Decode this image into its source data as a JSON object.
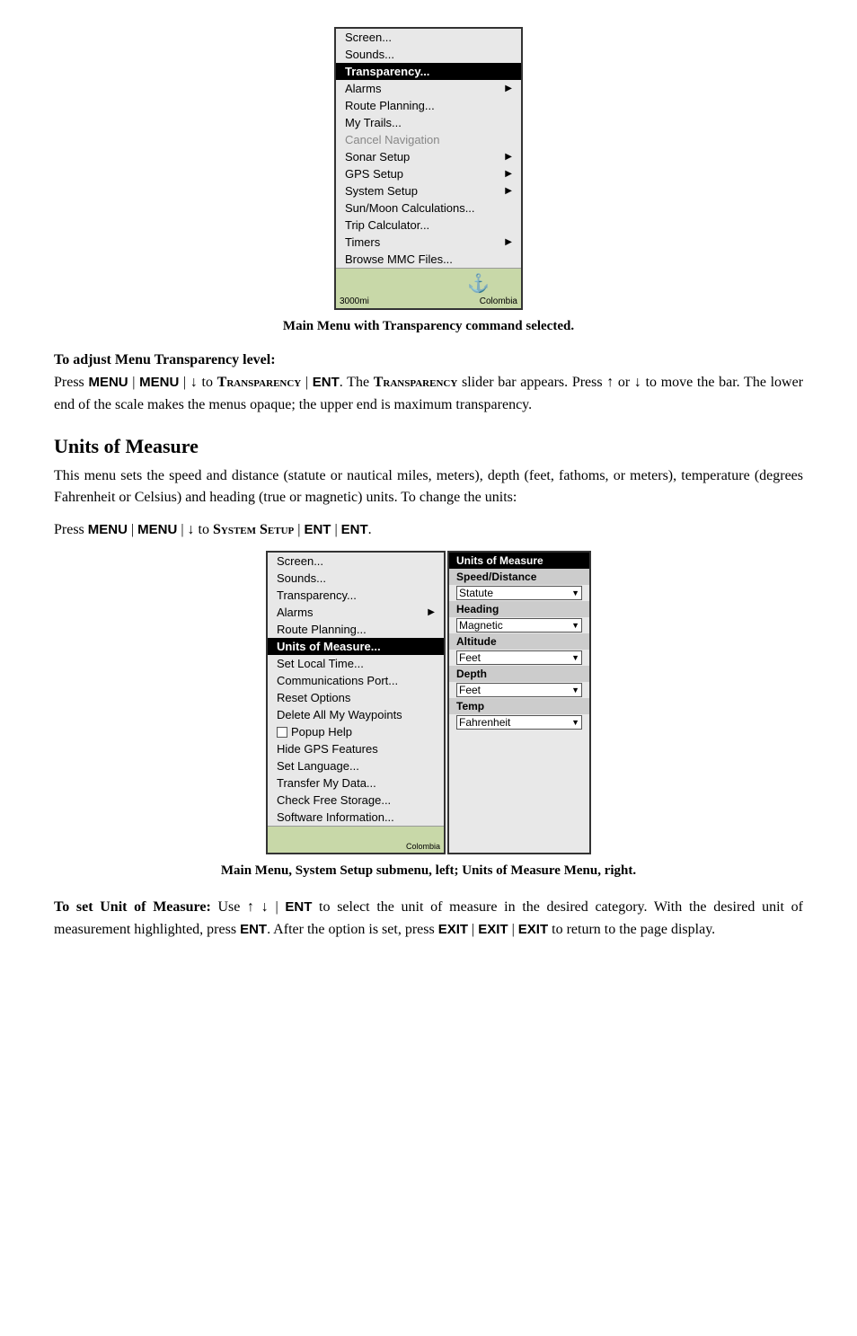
{
  "menu1": {
    "items": [
      {
        "label": "Screen...",
        "type": "normal"
      },
      {
        "label": "Sounds...",
        "type": "normal"
      },
      {
        "label": "Transparency...",
        "type": "highlighted"
      },
      {
        "label": "Alarms",
        "type": "arrow"
      },
      {
        "label": "Route Planning...",
        "type": "normal"
      },
      {
        "label": "My Trails...",
        "type": "normal"
      },
      {
        "label": "Cancel Navigation",
        "type": "disabled"
      },
      {
        "label": "Sonar Setup",
        "type": "arrow"
      },
      {
        "label": "GPS Setup",
        "type": "arrow"
      },
      {
        "label": "System Setup",
        "type": "arrow"
      },
      {
        "label": "Sun/Moon Calculations...",
        "type": "normal"
      },
      {
        "label": "Trip Calculator...",
        "type": "normal"
      },
      {
        "label": "Timers",
        "type": "arrow"
      },
      {
        "label": "Browse MMC Files...",
        "type": "normal"
      }
    ],
    "map_left": "3000mi",
    "map_right": "Colombia"
  },
  "caption1": "Main Menu with Transparency command selected.",
  "section1": {
    "heading": "To adjust Menu Transparency level:",
    "text1": "Press ",
    "bold1": "MENU",
    "sep1": " | ",
    "bold2": "MENU",
    "sep2": " | ↓ to ",
    "smallcaps1": "Transparency",
    "sep3": " | ",
    "bold3": "ENT",
    "text2": ". The ",
    "smallcaps2": "Transparency",
    "text3": " slider bar appears. Press ↑ or ↓ to move the bar. The lower end of the scale makes the menus opaque; the upper end is maximum transparency."
  },
  "section2": {
    "heading": "Units of Measure",
    "body": "This menu sets the speed and distance (statute or nautical miles, meters), depth (feet, fathoms, or meters), temperature (degrees Fahrenheit or Celsius) and heading (true or magnetic) units. To change the units:"
  },
  "pressline2": {
    "text1": "Press ",
    "bold1": "MENU",
    "sep1": " | ",
    "bold2": "MENU",
    "sep2": " | ↓ to ",
    "smallcaps1": "System Setup",
    "sep3": " | ",
    "bold3": "ENT",
    "sep4": " | ",
    "bold4": "ENT",
    "text2": "."
  },
  "menu2_left": {
    "items": [
      {
        "label": "Screen...",
        "type": "normal"
      },
      {
        "label": "Sounds...",
        "type": "normal"
      },
      {
        "label": "Transparency...",
        "type": "normal"
      },
      {
        "label": "Alarms",
        "type": "arrow"
      },
      {
        "label": "Route Planning...",
        "type": "normal"
      },
      {
        "label": "Units of Measure...",
        "type": "highlighted"
      },
      {
        "label": "Set Local Time...",
        "type": "normal"
      },
      {
        "label": "Communications Port...",
        "type": "normal"
      },
      {
        "label": "Reset Options",
        "type": "normal"
      },
      {
        "label": "Delete All My Waypoints",
        "type": "normal"
      },
      {
        "label": "Popup Help",
        "type": "checkbox"
      },
      {
        "label": "Hide GPS Features",
        "type": "normal"
      },
      {
        "label": "Set Language...",
        "type": "normal"
      },
      {
        "label": "Transfer My Data...",
        "type": "normal"
      },
      {
        "label": "Check Free Storage...",
        "type": "normal"
      },
      {
        "label": "Software Information...",
        "type": "normal"
      }
    ],
    "map_right": "Colombia"
  },
  "menu2_right": {
    "header": "Units of Measure",
    "sections": [
      {
        "type": "section_label",
        "label": "Speed/Distance"
      },
      {
        "type": "dropdown",
        "value": "Statute"
      },
      {
        "type": "section_label",
        "label": "Heading"
      },
      {
        "type": "dropdown",
        "value": "Magnetic"
      },
      {
        "type": "section_label",
        "label": "Altitude"
      },
      {
        "type": "dropdown",
        "value": "Feet"
      },
      {
        "type": "section_label",
        "label": "Depth"
      },
      {
        "type": "dropdown",
        "value": "Feet"
      },
      {
        "type": "section_label",
        "label": "Temp"
      },
      {
        "type": "dropdown",
        "value": "Fahrenheit"
      }
    ]
  },
  "caption2": "Main Menu, System Setup submenu, left; Units of Measure Menu, right.",
  "section3": {
    "bold_intro": "To set Unit of Measure:",
    "text": " Use ↑ ↓ | ENT to select the unit of measure in the desired category. With the desired unit of measurement highlighted, press ",
    "bold1": "ENT",
    "text2": ". After the option is set, press ",
    "bold2": "EXIT",
    "sep1": " | ",
    "bold3": "EXIT",
    "sep2": " | ",
    "bold4": "EXIT",
    "text3": " to return to the page display."
  }
}
